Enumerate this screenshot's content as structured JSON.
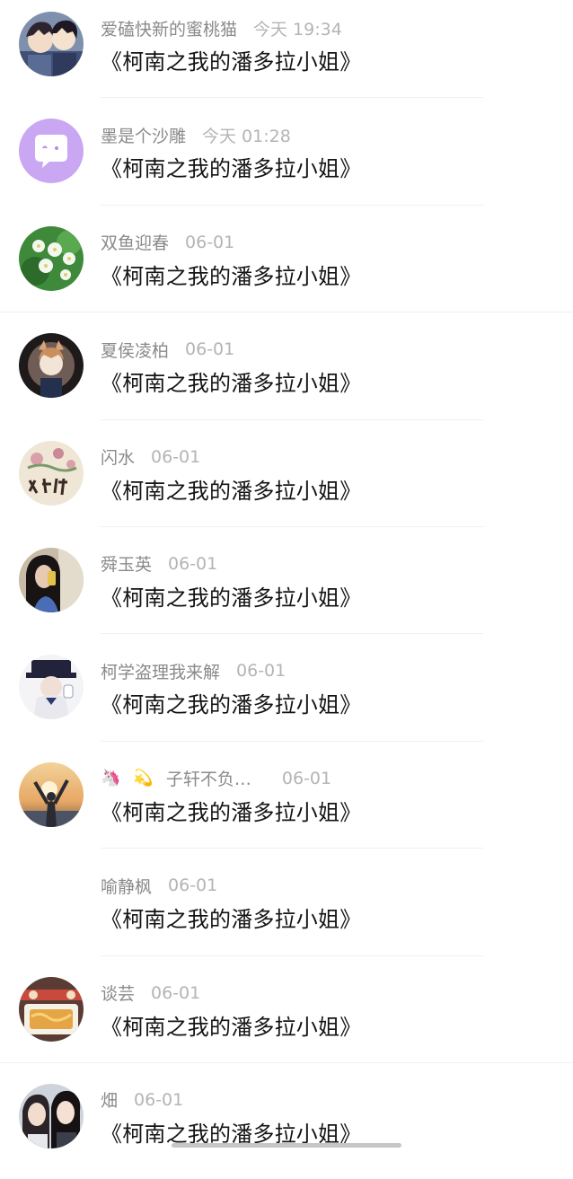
{
  "comments": [
    {
      "name": "爱磕快新的蜜桃猫",
      "time": "今天  19:34",
      "message": "《柯南之我的潘多拉小姐》",
      "avatar": "anime-boys-avatar"
    },
    {
      "name": "墨是个沙雕",
      "time": "今天  01:28",
      "message": "《柯南之我的潘多拉小姐》",
      "avatar": "chat-bubble-avatar"
    },
    {
      "name": "双鱼迎春",
      "time": "06-01",
      "message": "《柯南之我的潘多拉小姐》",
      "avatar": "white-flowers-avatar"
    },
    {
      "name": "夏侯凌柏",
      "time": "06-01",
      "message": "《柯南之我的潘多拉小姐》",
      "avatar": "anime-fox-girl-avatar"
    },
    {
      "name": "闪水",
      "time": "06-01",
      "message": "《柯南之我的潘多拉小姐》",
      "avatar": "floral-calligraphy-avatar"
    },
    {
      "name": "舜玉英",
      "time": "06-01",
      "message": "《柯南之我的潘多拉小姐》",
      "avatar": "woman-selfie-avatar"
    },
    {
      "name": "柯学盗理我来解",
      "time": "06-01",
      "message": "《柯南之我的潘多拉小姐》",
      "avatar": "kaito-kid-avatar"
    },
    {
      "name": "子轩不负…",
      "emojis": [
        "🦄",
        "💫"
      ],
      "time": "06-01",
      "message": "《柯南之我的潘多拉小姐》",
      "avatar": "sunset-silhouette-avatar"
    },
    {
      "name": "喻静枫",
      "time": "06-01",
      "message": "《柯南之我的潘多拉小姐》",
      "avatar": ""
    },
    {
      "name": "谈芸",
      "time": "06-01",
      "message": "《柯南之我的潘多拉小姐》",
      "avatar": "food-tray-avatar"
    },
    {
      "name": "畑",
      "time": "06-01",
      "message": "《柯南之我的潘多拉小姐》",
      "avatar": "two-girls-avatar"
    }
  ],
  "colors": {
    "name": "#8a8a8a",
    "time": "#b4b4b4",
    "message": "#141414",
    "divider": "#f1f1f1",
    "background": "#ffffff"
  }
}
